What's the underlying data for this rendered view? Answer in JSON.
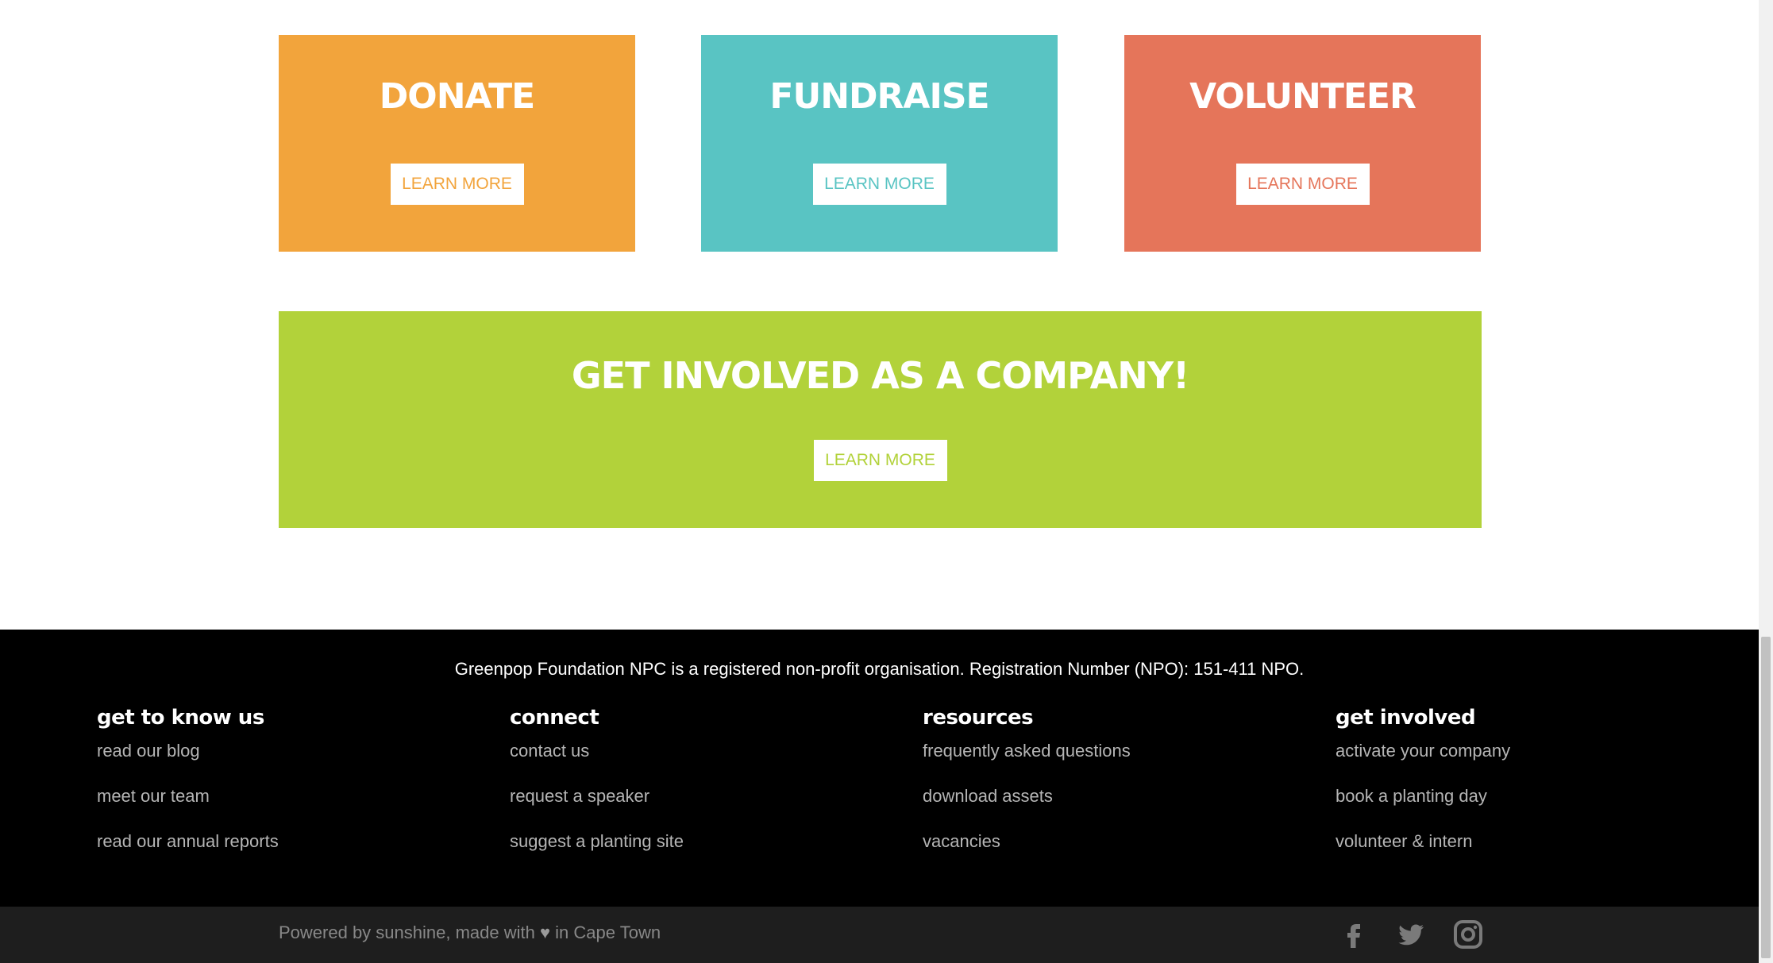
{
  "cards": [
    {
      "title": "DONATE",
      "button": "LEARN MORE",
      "color": "#f2a43c"
    },
    {
      "title": "FUNDRAISE",
      "button": "LEARN MORE",
      "color": "#59c4c3"
    },
    {
      "title": "VOLUNTEER",
      "button": "LEARN MORE",
      "color": "#e5755a"
    }
  ],
  "banner": {
    "title": "GET INVOLVED AS A COMPANY!",
    "button": "LEARN MORE",
    "color": "#b2d23a"
  },
  "footer": {
    "registration": "Greenpop Foundation NPC is a registered non-profit organisation. Registration Number (NPO): 151-411 NPO.",
    "columns": [
      {
        "heading": "get to know us",
        "links": [
          "read our blog",
          "meet our team",
          "read our annual reports"
        ]
      },
      {
        "heading": "connect",
        "links": [
          "contact us",
          "request a speaker",
          "suggest a planting site"
        ]
      },
      {
        "heading": "resources",
        "links": [
          "frequently asked questions",
          "download assets",
          "vacancies"
        ]
      },
      {
        "heading": "get involved",
        "links": [
          "activate your company",
          "book a planting day",
          "volunteer & intern"
        ]
      }
    ]
  },
  "bottom_bar": {
    "credits_before": "Powered by sunshine, made with",
    "credits_after": "in Cape Town",
    "heart_icon": "heart-icon",
    "socials": [
      "facebook-icon",
      "twitter-icon",
      "instagram-icon"
    ]
  }
}
